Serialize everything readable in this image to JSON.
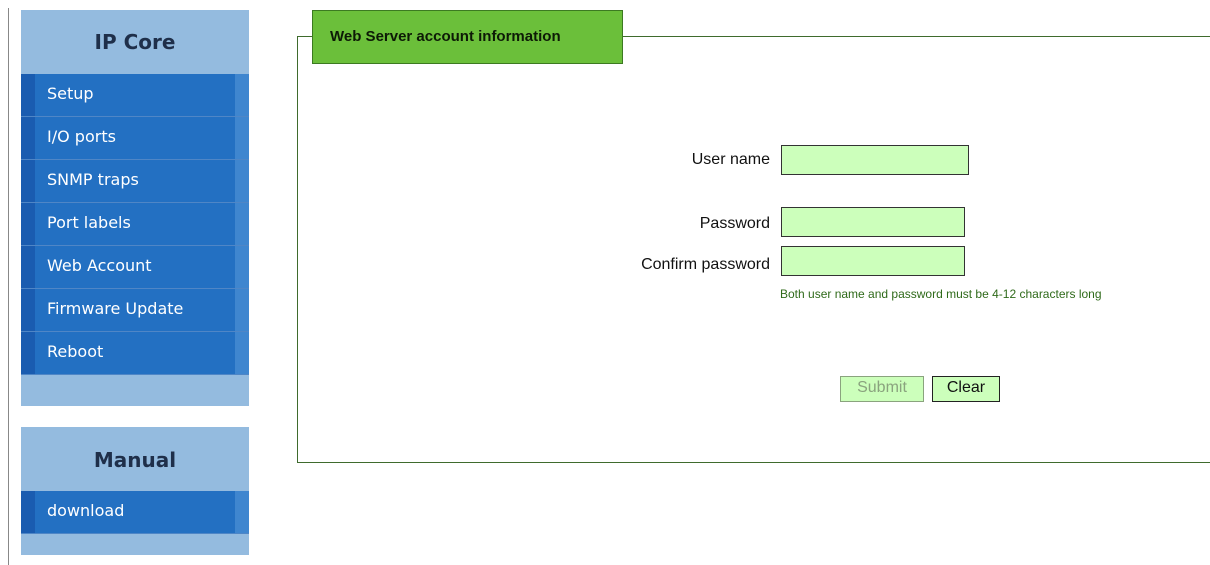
{
  "sidebar": {
    "ipcore_title": "IP Core",
    "ipcore_items": [
      {
        "label": "Setup"
      },
      {
        "label": "I/O ports"
      },
      {
        "label": "SNMP traps"
      },
      {
        "label": "Port labels"
      },
      {
        "label": "Web Account"
      },
      {
        "label": "Firmware Update"
      },
      {
        "label": "Reboot"
      }
    ],
    "manual_title": "Manual",
    "manual_items": [
      {
        "label": "download"
      }
    ]
  },
  "panel": {
    "title": "Web Server account information",
    "fields": {
      "username": {
        "label": "User name",
        "value": ""
      },
      "password": {
        "label": "Password",
        "value": ""
      },
      "confirm": {
        "label": "Confirm password",
        "value": ""
      }
    },
    "hint": "Both user name and password must be 4-12 characters long",
    "submit_label": "Submit",
    "clear_label": "Clear"
  },
  "colors": {
    "menu_bg": "#94bbdf",
    "menu_item_bg": "#2370c2",
    "legend_bg": "#6bbf3a",
    "input_bg": "#ccffbb",
    "hint_text": "#2f6a1a"
  }
}
